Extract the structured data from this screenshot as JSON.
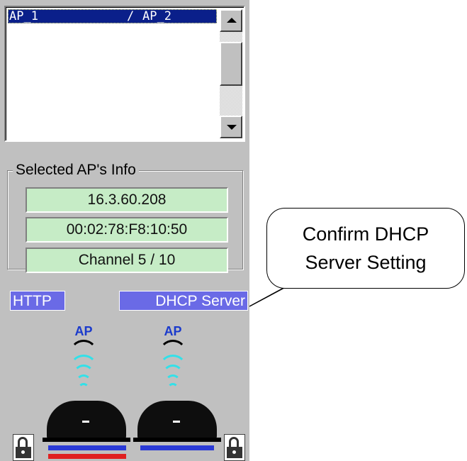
{
  "ap_list": {
    "selected_row": {
      "left": "AP_1",
      "separator": "/",
      "right": "AP_2"
    }
  },
  "selected_ap_info": {
    "title": "Selected AP's Info",
    "ip_address": "16.3.60.208",
    "mac_address": "00:02:78:F8:10:50",
    "channel": "Channel 5 / 10"
  },
  "labels": {
    "http": "HTTP",
    "dhcp_server": "DHCP Server"
  },
  "access_points": [
    {
      "label": "AP",
      "bars": [
        "#2a3ad6",
        "#e02020"
      ]
    },
    {
      "label": "AP",
      "bars": [
        "#2a3ad6"
      ]
    }
  ],
  "callout": {
    "line1": "Confirm DHCP",
    "line2": "Server Setting"
  },
  "colors": {
    "panel_bg": "#c0c0c0",
    "selection": "#0a1f8a",
    "info_field": "#c6ecc6",
    "label_bg": "#6a6ae6",
    "wave": "#33e0e8",
    "ap_text": "#1a3acc"
  }
}
